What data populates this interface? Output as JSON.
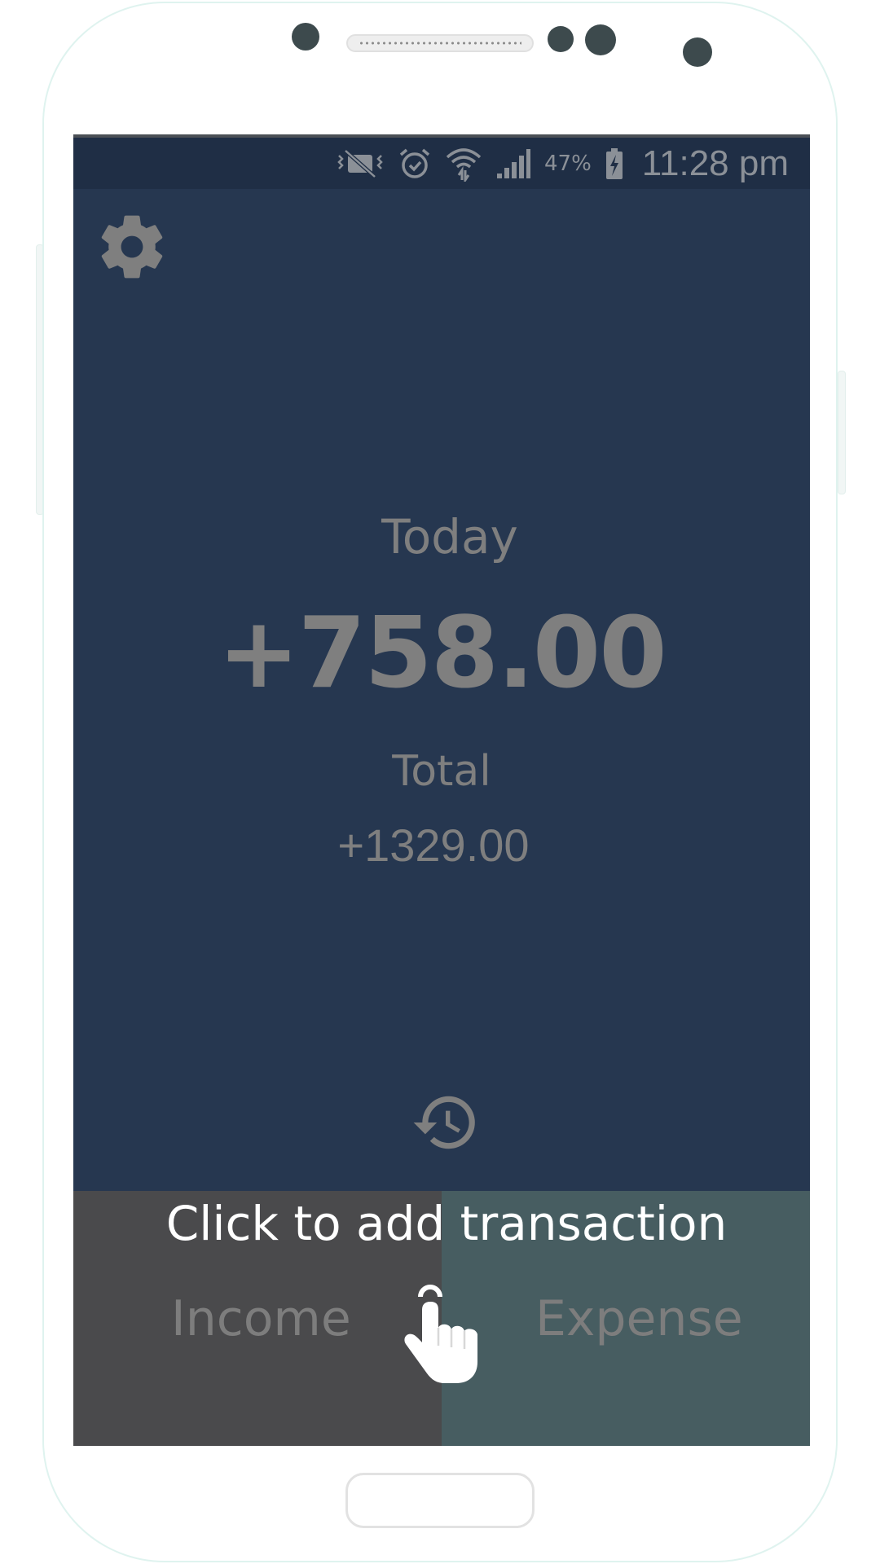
{
  "status_bar": {
    "battery_percent": "47%",
    "time": "11:28 pm",
    "icons": [
      "vibrate-mute-icon",
      "alarm-icon",
      "wifi-icon",
      "signal-icon",
      "battery-charging-icon"
    ]
  },
  "main": {
    "today_label": "Today",
    "today_value": "+758.00",
    "total_label": "Total",
    "total_value": "+1329.00",
    "settings_icon": "gear-icon",
    "history_icon": "history-icon"
  },
  "actions": {
    "tutorial_text": "Click to add transaction",
    "income_label": "Income",
    "expense_label": "Expense",
    "pointer_icon": "hand-pointer-icon"
  },
  "colors": {
    "background": "#263750",
    "status_bar": "#1f2e45",
    "income": "#4a4a4c",
    "expense": "#475d61",
    "text_muted": "#7f7f7f"
  }
}
